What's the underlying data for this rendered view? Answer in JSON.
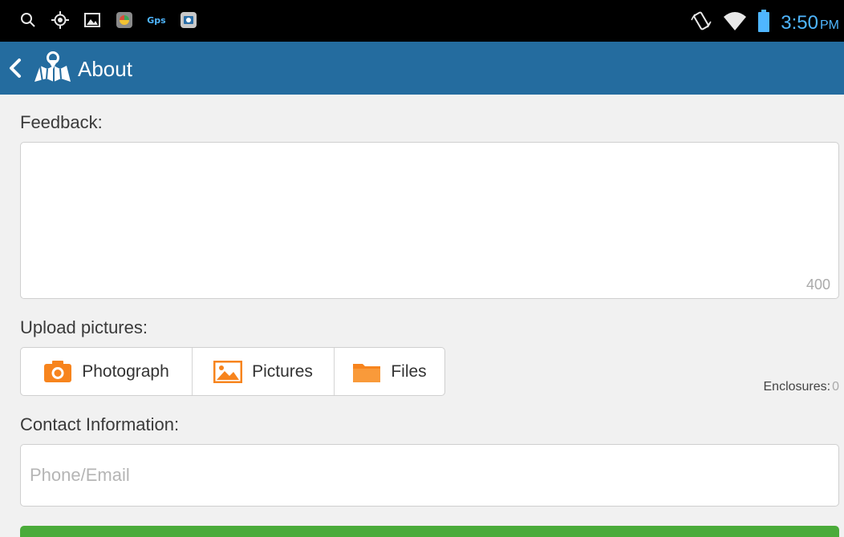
{
  "status_bar": {
    "left_icons": [
      "search-icon",
      "gps-target-icon",
      "image-icon",
      "app-icon",
      "gps-label",
      "camera-app-icon"
    ],
    "gps_label": "Gps",
    "time": "3:50",
    "ampm": "PM"
  },
  "action_bar": {
    "title": "About"
  },
  "feedback": {
    "label": "Feedback:",
    "value": "",
    "counter": "400"
  },
  "upload": {
    "label": "Upload pictures:",
    "buttons": [
      {
        "label": "Photograph",
        "icon": "camera-icon"
      },
      {
        "label": "Pictures",
        "icon": "picture-icon"
      },
      {
        "label": "Files",
        "icon": "folder-icon"
      }
    ],
    "enclosures_label": "Enclosures:",
    "enclosures_count": "0"
  },
  "contact": {
    "label": "Contact Information:",
    "placeholder": "Phone/Email"
  },
  "colors": {
    "action_bar": "#246c9f",
    "accent_orange": "#f7841d",
    "submit_green": "#4aab3a",
    "clock_blue": "#4fb6ff"
  }
}
